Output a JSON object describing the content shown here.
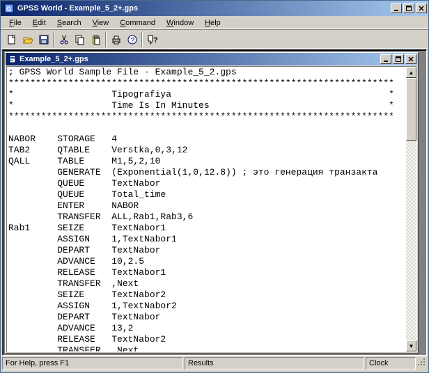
{
  "window": {
    "title": "GPSS World - Example_5_2+.gps",
    "icon": "app-icon"
  },
  "menu": [
    "File",
    "Edit",
    "Search",
    "View",
    "Command",
    "Window",
    "Help"
  ],
  "toolbar": {
    "new": "new-icon",
    "open": "open-icon",
    "save": "save-icon",
    "cut": "cut-icon",
    "copy": "copy-icon",
    "paste": "paste-icon",
    "print": "print-icon",
    "build": "build-icon",
    "whatsthis": "whatsthis-icon"
  },
  "child": {
    "title": "Example_5_2+.gps",
    "icon": "doc-icon"
  },
  "code": "; GPSS World Sample File - Example_5_2.gps\n***********************************************************************\n*                  Tipografiya                                        *\n*                  Time Is In Minutes                                 *\n***********************************************************************\n\nNABOR    STORAGE   4\nTAB2     QTABLE    Verstka,0,3,12\nQALL     TABLE     M1,5,2,10\n         GENERATE  (Exponential(1,0,12.8)) ; это генерация транзакта\n         QUEUE     TextNabor\n         QUEUE     Total_time\n         ENTER     NABOR\n         TRANSFER  ALL,Rab1,Rab3,6\nRab1     SEIZE     TextNabor1\n         ASSIGN    1,TextNabor1\n         DEPART    TextNabor\n         ADVANCE   10,2.5\n         RELEASE   TextNabor1\n         TRANSFER  ,Next\n         SEIZE     TextNabor2\n         ASSIGN    1,TextNabor2\n         DEPART    TextNabor\n         ADVANCE   13,2\n         RELEASE   TextNabor2\n         TRANSFER  ,Next",
  "status": {
    "help": "For Help, press F1",
    "results": "Results",
    "clock": "Clock"
  }
}
